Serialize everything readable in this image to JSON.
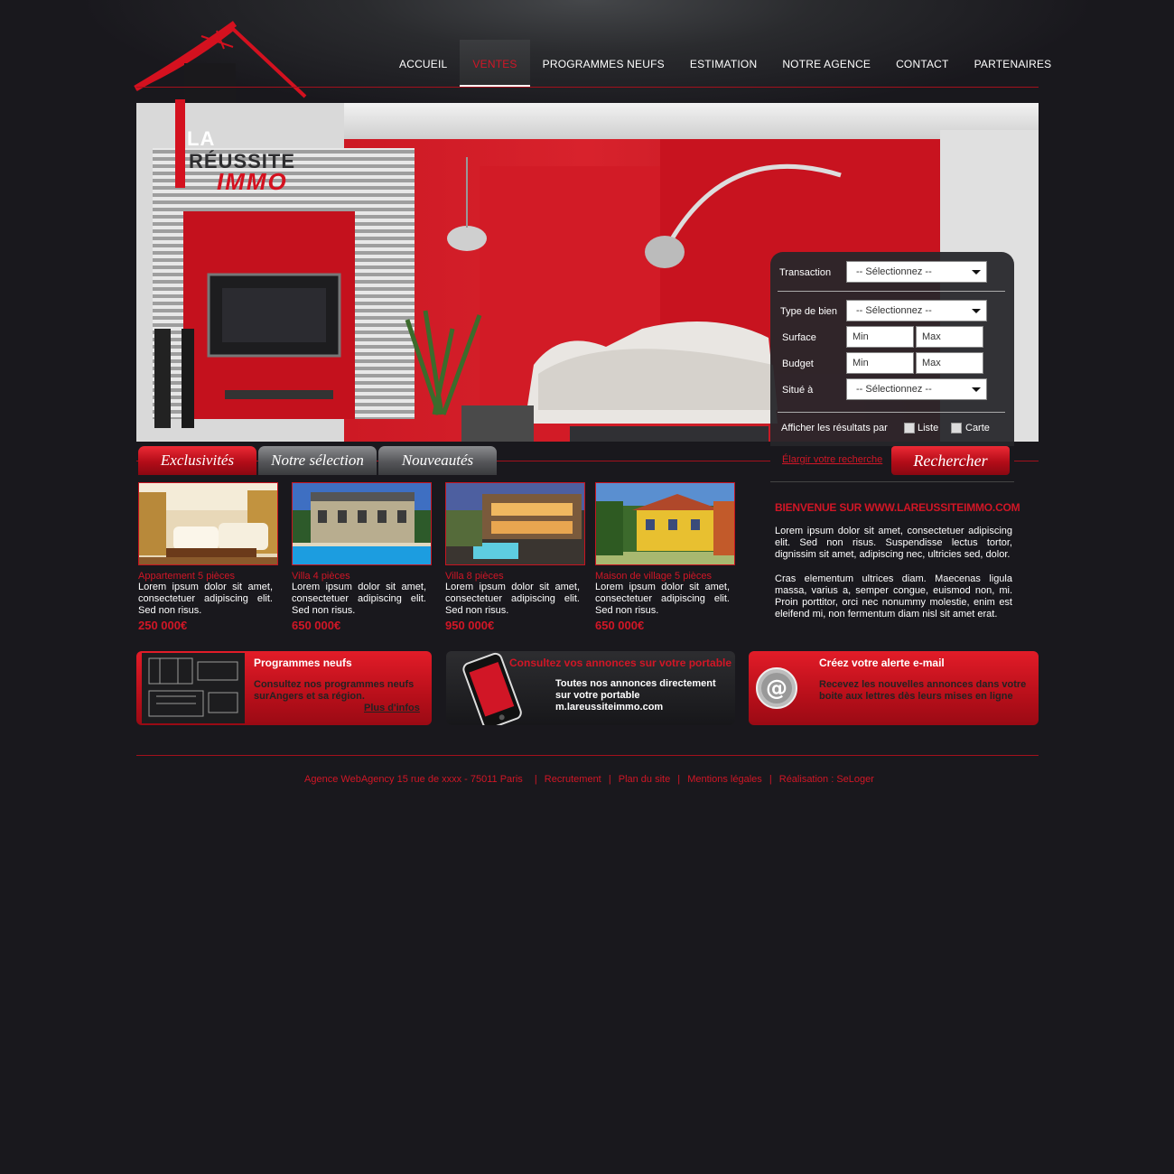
{
  "logo": {
    "line1": "LA",
    "line2": "RÉUSSITE",
    "line3": "IMMO"
  },
  "nav": {
    "items": [
      {
        "label": "ACCUEIL",
        "active": false
      },
      {
        "label": "VENTES",
        "active": true
      },
      {
        "label": "PROGRAMMES NEUFS",
        "active": false
      },
      {
        "label": "ESTIMATION",
        "active": false
      },
      {
        "label": "NOTRE AGENCE",
        "active": false
      },
      {
        "label": "CONTACT",
        "active": false
      },
      {
        "label": "PARTENAIRES",
        "active": false
      }
    ]
  },
  "search": {
    "transaction_label": "Transaction",
    "transaction_value": "-- Sélectionnez --",
    "type_label": "Type de bien",
    "type_value": "-- Sélectionnez --",
    "surface_label": "Surface",
    "surface_min": "Min",
    "surface_max": "Max",
    "budget_label": "Budget",
    "budget_min": "Min",
    "budget_max": "Max",
    "situe_label": "Situé à",
    "situe_value": "-- Sélectionnez --",
    "display_label": "Afficher les résultats par",
    "opt_liste": "Liste",
    "opt_carte": "Carte",
    "elargir": "Élargir votre recherche",
    "submit": "Rechercher"
  },
  "tabs": [
    "Exclusivités",
    "Notre sélection",
    "Nouveautés"
  ],
  "listings": [
    {
      "title": "Appartement 5 pièces",
      "desc": "Lorem ipsum dolor sit amet, consectetuer adipiscing elit. Sed non risus.",
      "price": "250 000€"
    },
    {
      "title": "Villa 4 pièces",
      "desc": "Lorem ipsum dolor sit amet, consectetuer adipiscing elit. Sed non risus.",
      "price": "650 000€"
    },
    {
      "title": "Villa 8 pièces",
      "desc": "Lorem ipsum dolor sit amet, consectetuer adipiscing elit. Sed non risus.",
      "price": "950 000€"
    },
    {
      "title": "Maison de village 5 pièces",
      "desc": "Lorem ipsum dolor sit amet, consectetuer adipiscing elit. Sed non risus.",
      "price": "650 000€"
    }
  ],
  "welcome": {
    "title": "BIENVENUE SUR WWW.LAREUSSITEIMMO.COM",
    "p1": "Lorem ipsum dolor sit amet, consectetuer adipiscing elit. Sed non risus. Suspendisse lectus tortor, dignissim sit amet, adipiscing nec, ultricies sed, dolor.",
    "p2": "Cras elementum ultrices diam. Maecenas ligula massa, varius a, semper congue, euismod non, mi. Proin porttitor, orci nec nonummy molestie, enim est eleifend mi, non fermentum diam nisl sit amet erat."
  },
  "promos": {
    "programmes": {
      "title": "Programmes neufs",
      "text": "Consultez nos programmes neufs surAngers et sa région.",
      "link": "Plus d'infos"
    },
    "mobile": {
      "title": "Consultez vos annonces sur votre portable",
      "text": "Toutes nos annonces directement sur votre portable m.lareussiteimmo.com"
    },
    "alerte": {
      "title": "Créez votre alerte e-mail",
      "text": "Recevez les nouvelles annonces dans votre boite aux lettres dès leurs mises en ligne"
    }
  },
  "footer": {
    "address": "Agence WebAgency 15 rue de xxxx - 75011 Paris",
    "sep": "|",
    "recrutement": "Recrutement",
    "plan": "Plan du site",
    "mentions": "Mentions légales",
    "realisation": "Réalisation : SeLoger"
  }
}
